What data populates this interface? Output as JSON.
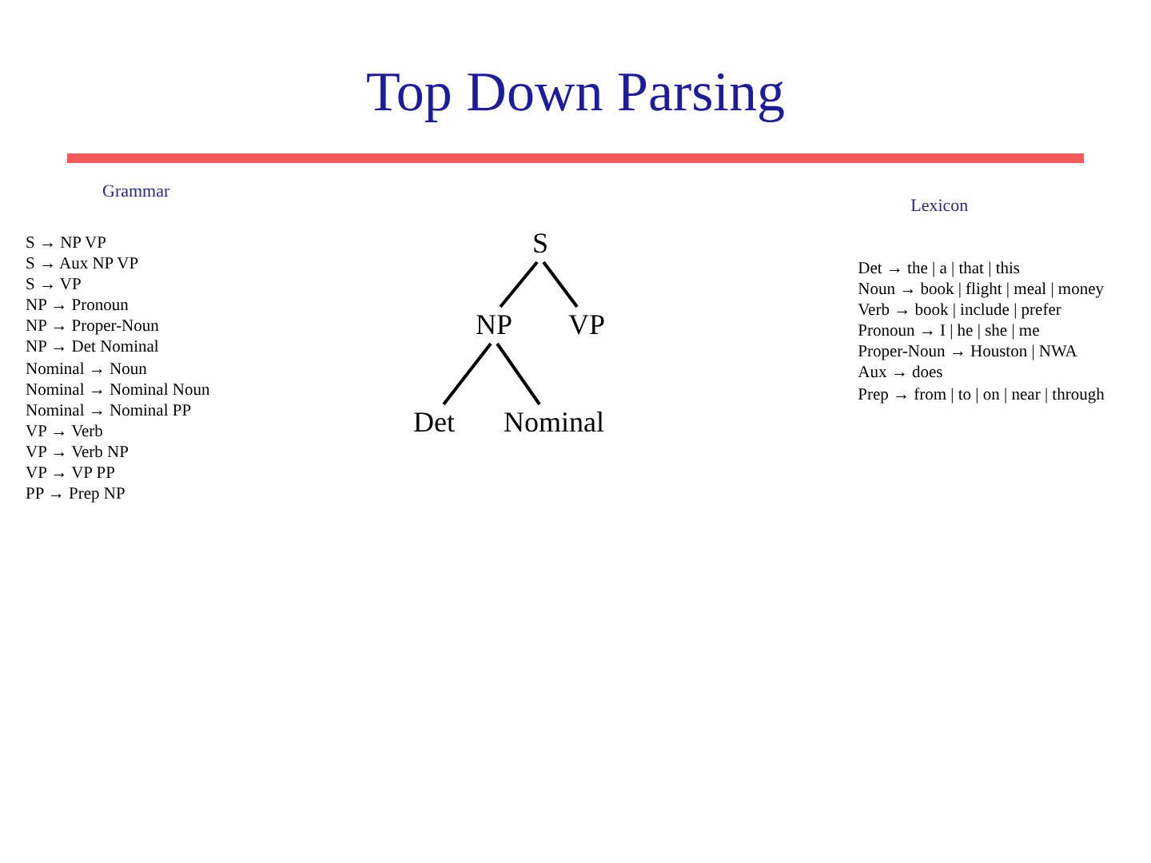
{
  "title": "Top Down Parsing",
  "grammar": {
    "heading": "Grammar",
    "rules": [
      "S → NP VP",
      "S → Aux NP VP",
      "S → VP",
      "NP → Pronoun",
      "NP → Proper-Noun",
      "NP → Det Nominal",
      "Nominal → Noun",
      "Nominal → Nominal Noun",
      "Nominal → Nominal PP",
      "VP → Verb",
      "VP → Verb NP",
      "VP → VP PP",
      "PP → Prep NP"
    ]
  },
  "tree": {
    "label": "S",
    "children": [
      {
        "label": "NP",
        "children": [
          {
            "label": "Det"
          },
          {
            "label": "Nominal"
          }
        ]
      },
      {
        "label": "VP"
      }
    ]
  },
  "lexicon": {
    "heading": "Lexicon",
    "entries": [
      "Det → the | a | that | this",
      "Noun → book | flight | meal | money",
      "Verb → book | include | prefer",
      "Pronoun → I | he | she | me",
      "Proper-Noun → Houston | NWA",
      "Aux → does",
      "Prep → from | to | on | near | through"
    ]
  }
}
